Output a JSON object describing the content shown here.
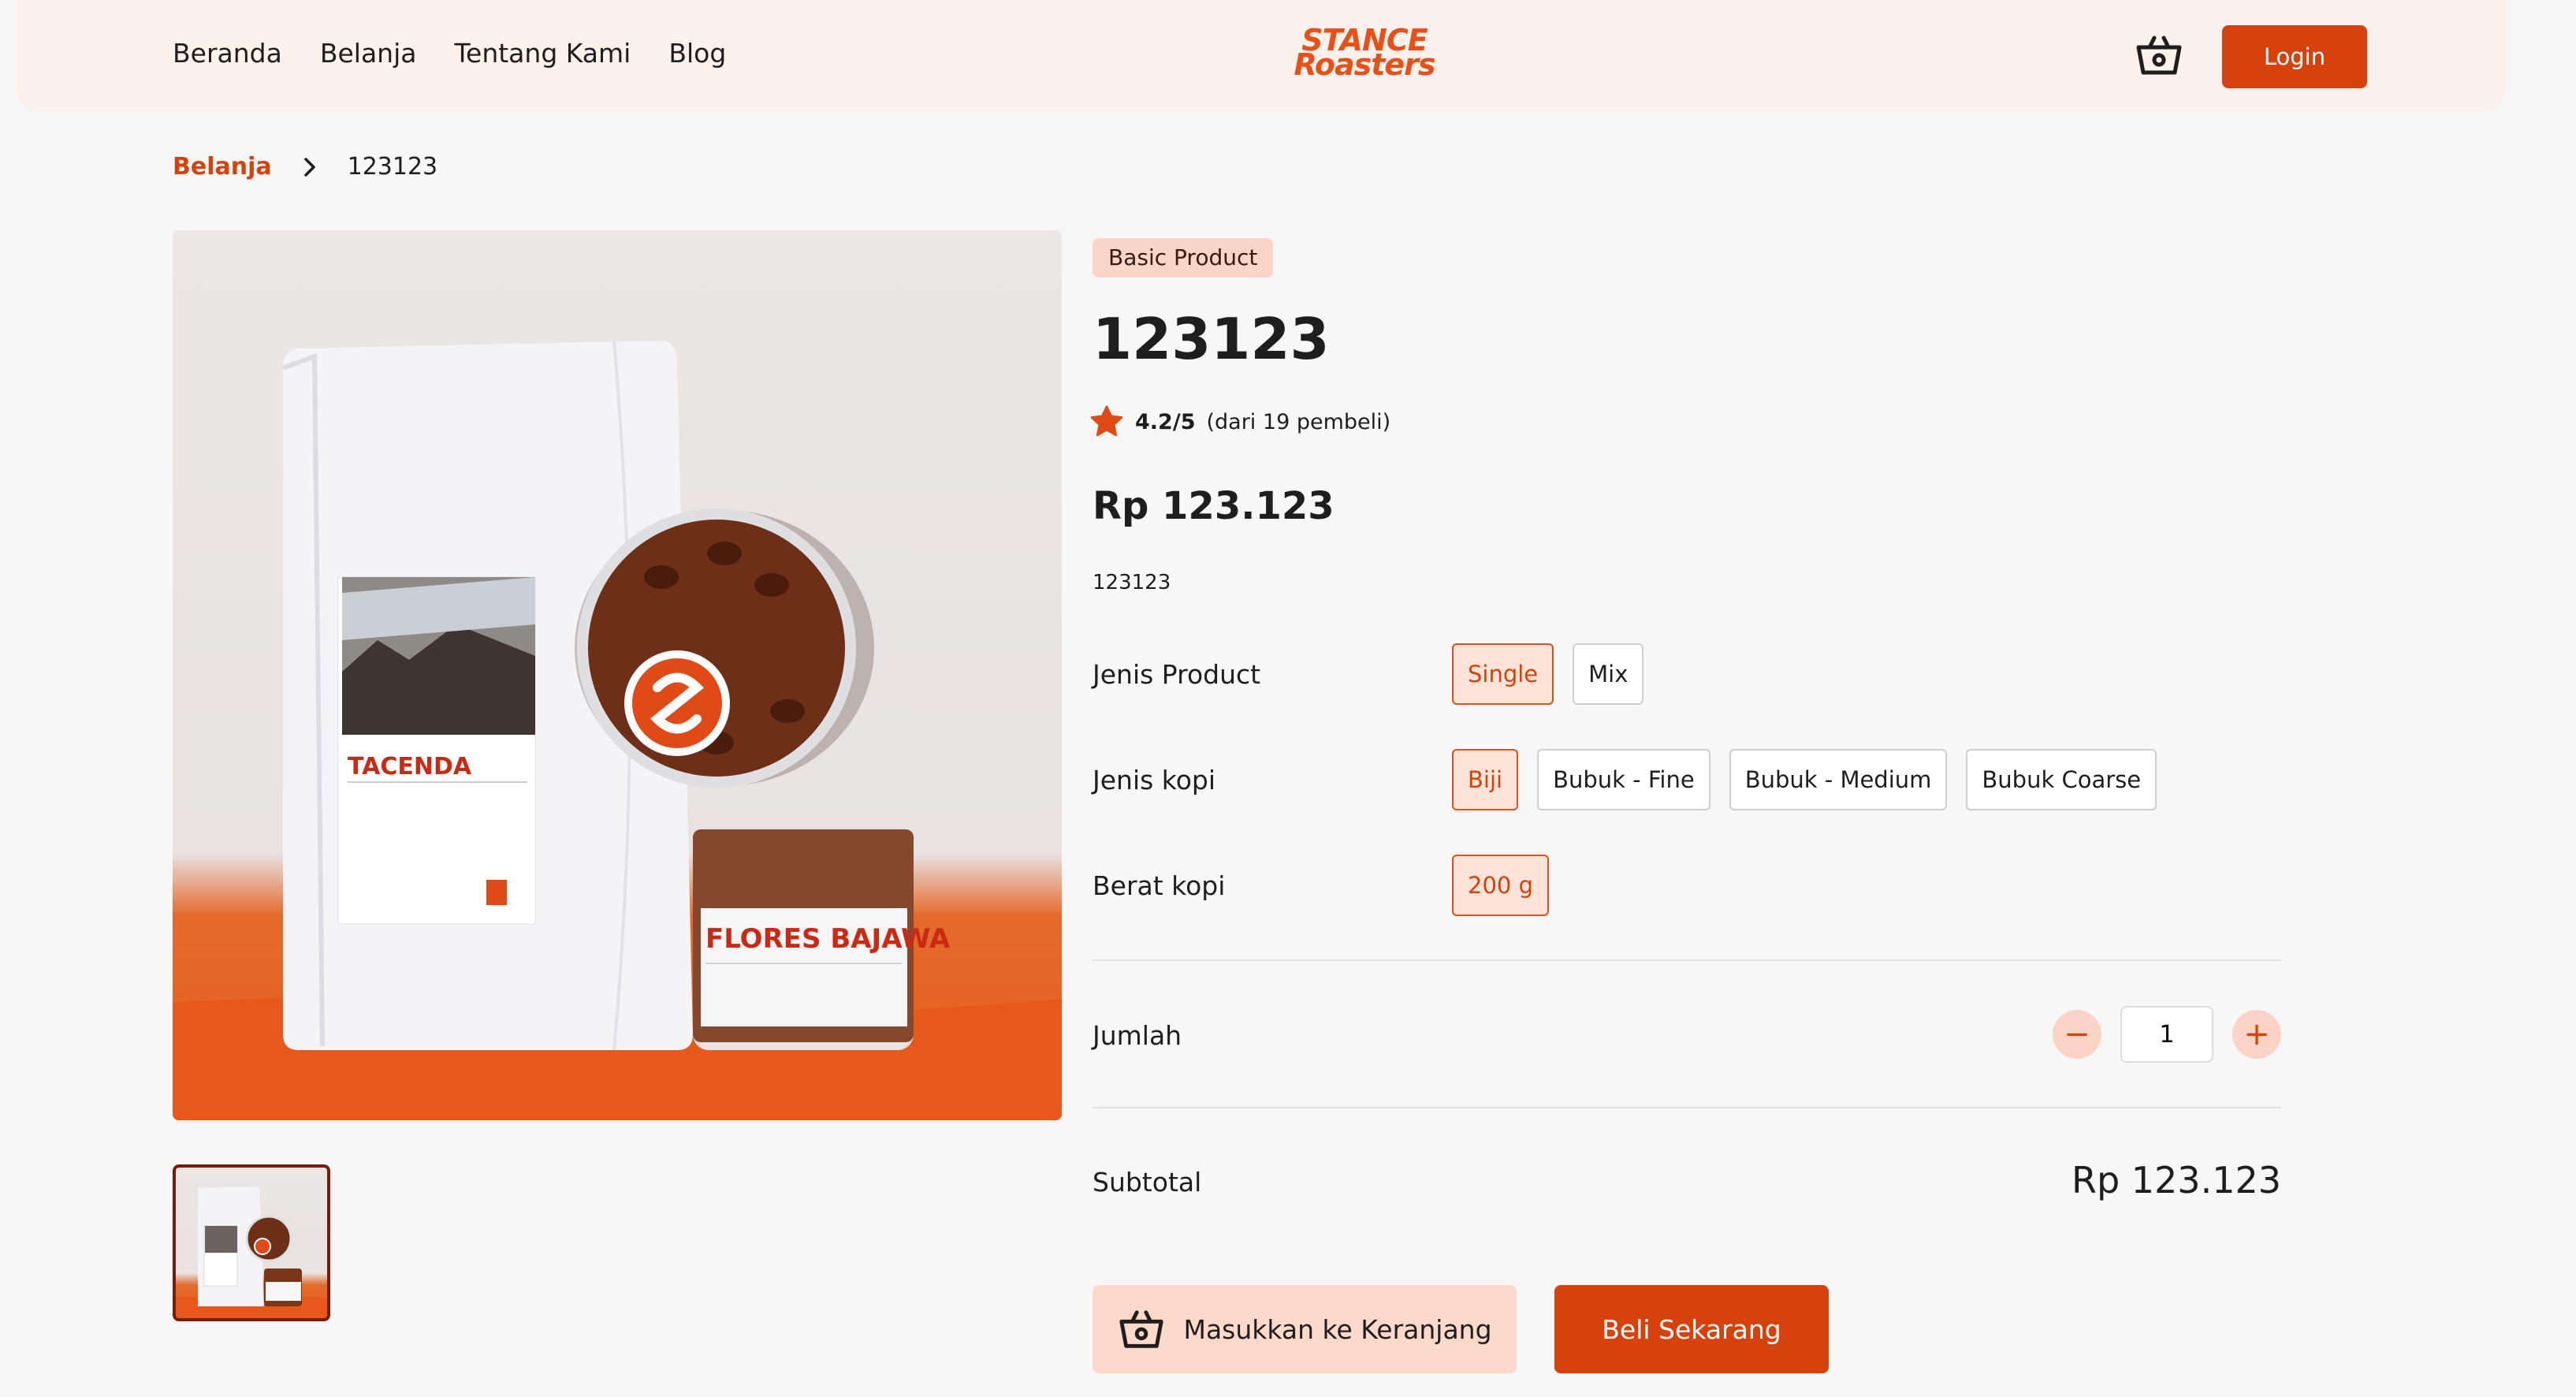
{
  "nav": {
    "links": [
      "Beranda",
      "Belanja",
      "Tentang Kami",
      "Blog"
    ],
    "brand_line1": "STANCE",
    "brand_line2": "Roasters",
    "login_label": "Login"
  },
  "breadcrumb": {
    "parent": "Belanja",
    "current": "123123"
  },
  "product": {
    "badge": "Basic Product",
    "title": "123123",
    "rating_score": "4.2/5",
    "rating_count": "(dari 19 pembeli)",
    "price": "Rp 123.123",
    "description": "123123",
    "image_texts": {
      "bag_label": "TACENDA",
      "jar_label": "FLORES BAJAWA"
    }
  },
  "options": {
    "jenis_product": {
      "label": "Jenis Product",
      "values": [
        "Single",
        "Mix"
      ],
      "selected": "Single"
    },
    "jenis_kopi": {
      "label": "Jenis kopi",
      "values": [
        "Biji",
        "Bubuk - Fine",
        "Bubuk - Medium",
        "Bubuk Coarse"
      ],
      "selected": "Biji"
    },
    "berat_kopi": {
      "label": "Berat kopi",
      "values": [
        "200 g"
      ],
      "selected": "200 g"
    }
  },
  "quantity": {
    "label": "Jumlah",
    "value": "1",
    "minus": "−",
    "plus": "+"
  },
  "subtotal": {
    "label": "Subtotal",
    "value": "Rp 123.123"
  },
  "actions": {
    "add_to_cart": "Masukkan ke Keranjang",
    "buy_now": "Beli Sekarang"
  },
  "colors": {
    "accent": "#d7410c",
    "accent_light": "#fde3d8",
    "nav_bg": "#fdf1ec",
    "star": "#e04a16"
  },
  "icons": [
    "basket-icon",
    "chevron-right-icon",
    "star-icon",
    "minus-icon",
    "plus-icon"
  ]
}
